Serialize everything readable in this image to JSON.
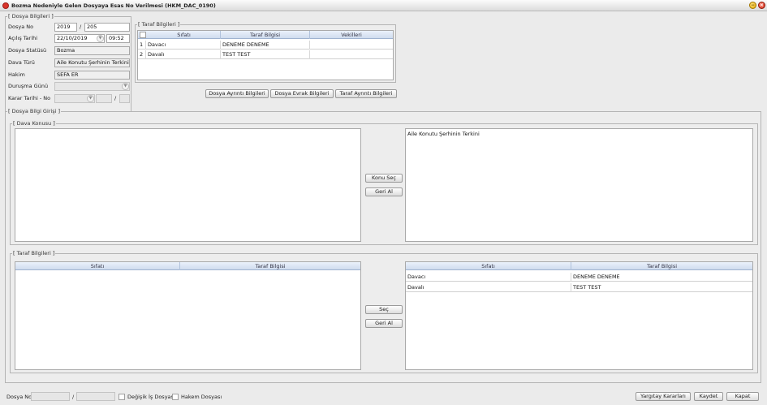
{
  "window": {
    "title": "Bozma Nedeniyle Gelen Dosyaya Esas No Verilmesi (HKM_DAC_0190)",
    "minimize": "‒",
    "close": "×"
  },
  "dosya": {
    "legend": "[ Dosya Bilgileri ]",
    "dosya_no_label": "Dosya No",
    "dosya_yil": "2019",
    "slash": "/",
    "dosya_sira": "205",
    "acilis_label": "Açılış Tarihi",
    "acilis_tarih": "22/10/2019",
    "acilis_saat": "09:52",
    "statu_label": "Dosya Statüsü",
    "statu": "Bozma",
    "tur_label": "Dava Türü",
    "tur": "Aile Konutu Şerhinin Terkini",
    "hakim_label": "Hakim",
    "hakim": "SEFA ER",
    "durusma_label": "Duruşma Günü",
    "karar_label": "Karar Tarihi - No",
    "karar_slash": "/"
  },
  "taraf_ust": {
    "legend": "[ Taraf Bilgileri ]",
    "headers": [
      "Sıfatı",
      "Taraf Bilgisi",
      "Vekilleri"
    ],
    "rows": [
      {
        "no": "1",
        "sifat": "Davacı",
        "taraf": "DENEME DENEME",
        "vekil": ""
      },
      {
        "no": "2",
        "sifat": "Davalı",
        "taraf": "TEST TEST",
        "vekil": ""
      }
    ]
  },
  "buttons_top": {
    "dosya_ayrinti": "Dosya Ayrıntı Bilgileri",
    "dosya_evrak": "Dosya Evrak Bilgileri",
    "taraf_ayrinti": "Taraf Ayrıntı Bilgileri"
  },
  "giris": {
    "legend": "[ Dosya Bilgi Girişi ]"
  },
  "konu": {
    "legend": "[ Dava Konusu ]",
    "left_text": "",
    "right_text": "Aile Konutu Şerhinin Terkini",
    "sec_button": "Konu Seç",
    "geri_button": "Geri Al"
  },
  "taraf_alt": {
    "legend": "[ Taraf Bilgileri ]",
    "left_headers": [
      "Sıfatı",
      "Taraf Bilgisi"
    ],
    "right_headers": [
      "Sıfatı",
      "Taraf Bilgisi"
    ],
    "right_rows": [
      {
        "sifat": "Davacı",
        "taraf": "DENEME DENEME"
      },
      {
        "sifat": "Davalı",
        "taraf": "TEST TEST"
      }
    ],
    "sec_button": "Seç",
    "geri_button": "Geri Al"
  },
  "footer": {
    "dosya_no_label": "Dosya No",
    "slash": "/",
    "degisik_label": "Değişik İş Dosyası",
    "hakem_label": "Hakem Dosyası",
    "yargitay_button": "Yargıtay Kararları",
    "kaydet_button": "Kaydet",
    "kapat_button": "Kapat"
  }
}
